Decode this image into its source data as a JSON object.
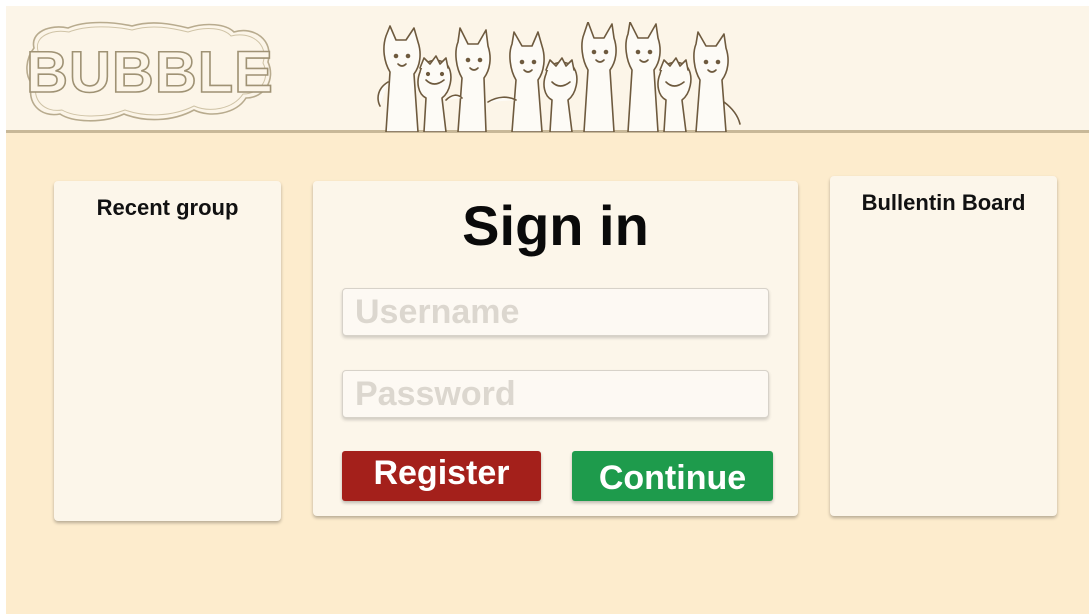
{
  "header": {
    "logo_text": "BUBBLE",
    "mascot_illustration": "group-of-cartoon-bunnies-and-kids-icon"
  },
  "left_panel": {
    "title": "Recent group"
  },
  "signin": {
    "title": "Sign in",
    "username": {
      "placeholder": "Username",
      "value": ""
    },
    "password": {
      "placeholder": "Password",
      "value": ""
    },
    "register_label": "Register",
    "continue_label": "Continue"
  },
  "right_panel": {
    "title": "Bullentin Board"
  },
  "colors": {
    "background": "#fdeccd",
    "header": "#fcf5e8",
    "panel": "#fcf6ea",
    "register": "#a4201b",
    "continue": "#1e9b4c"
  }
}
